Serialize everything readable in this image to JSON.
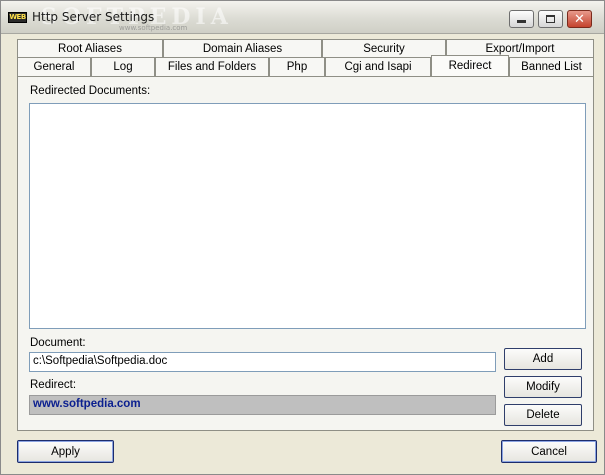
{
  "window": {
    "title": "Http Server Settings",
    "icon_label": "WEB",
    "watermark": "SOFTPEDIA",
    "watermark_small": "www.softpedia.com"
  },
  "tabs": {
    "row_top": [
      {
        "label": "Root Aliases"
      },
      {
        "label": "Domain Aliases"
      },
      {
        "label": "Security"
      },
      {
        "label": "Export/Import"
      }
    ],
    "row_bottom": [
      {
        "label": "General"
      },
      {
        "label": "Log"
      },
      {
        "label": "Files and Folders"
      },
      {
        "label": "Php"
      },
      {
        "label": "Cgi and Isapi"
      },
      {
        "label": "Redirect",
        "active": true
      },
      {
        "label": "Banned List"
      }
    ]
  },
  "redirect_panel": {
    "list_label": "Redirected Documents:",
    "list_items": [],
    "document_label": "Document:",
    "document_value": "c:\\Softpedia\\Softpedia.doc",
    "redirect_label": "Redirect:",
    "redirect_value": "www.softpedia.com",
    "add_label": "Add",
    "modify_label": "Modify",
    "delete_label": "Delete"
  },
  "footer": {
    "apply_label": "Apply",
    "cancel_label": "Cancel"
  },
  "colors": {
    "window_bg": "#ece9d8",
    "redirect_text": "#0b1f8f"
  }
}
